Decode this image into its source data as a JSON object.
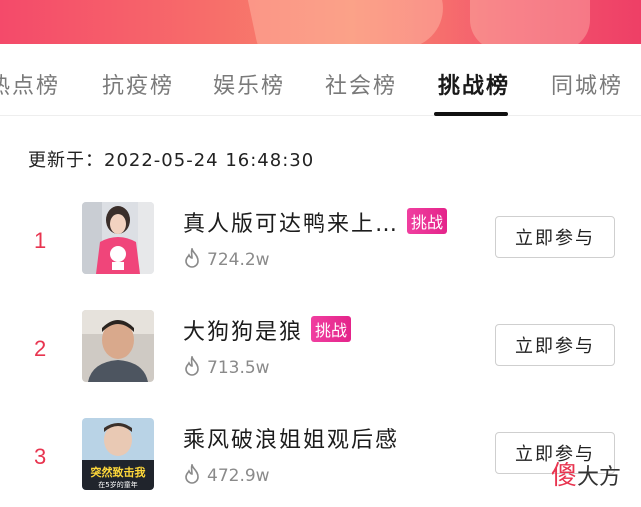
{
  "tabs": [
    {
      "label": "热点榜",
      "active": false
    },
    {
      "label": "抗疫榜",
      "active": false
    },
    {
      "label": "娱乐榜",
      "active": false
    },
    {
      "label": "社会榜",
      "active": false
    },
    {
      "label": "挑战榜",
      "active": true
    },
    {
      "label": "同城榜",
      "active": false
    }
  ],
  "updated_label": "更新于：2022-05-24 16:48:30",
  "items": [
    {
      "rank": "1",
      "title": "真人版可达鸭来上…",
      "badge": "挑战",
      "heat": "724.2w",
      "button": "立即参与"
    },
    {
      "rank": "2",
      "title": "大狗狗是狼",
      "badge": "挑战",
      "heat": "713.5w",
      "button": "立即参与"
    },
    {
      "rank": "3",
      "title": "乘风破浪姐姐观后感",
      "badge": "",
      "heat": "472.9w",
      "button": "立即参与",
      "thumb_caption_1": "突然致击我",
      "thumb_caption_2": "在5岁的童年"
    }
  ],
  "watermark": {
    "first": "傻",
    "rest": "大方"
  },
  "colors": {
    "accent": "#e8344f",
    "badge": "#e4248a",
    "banner": "#f4586e"
  }
}
